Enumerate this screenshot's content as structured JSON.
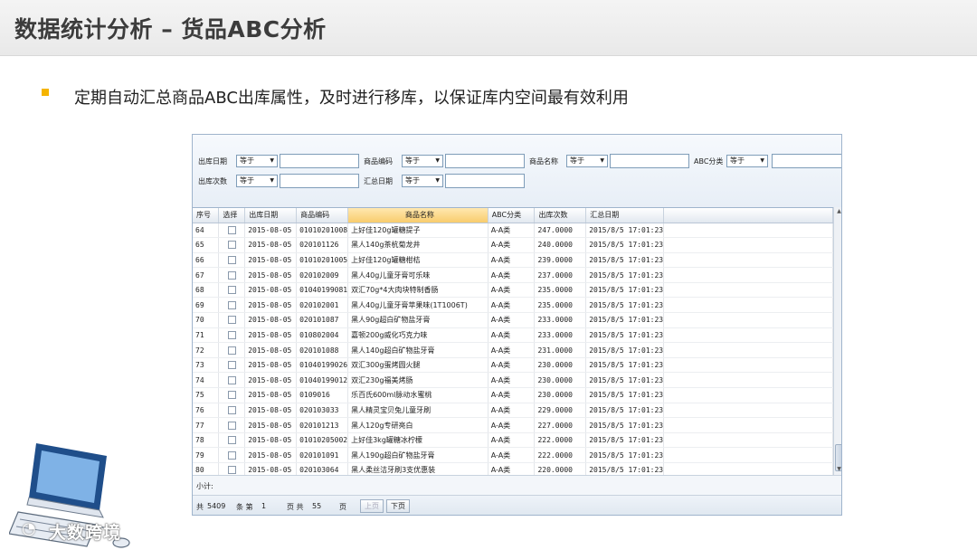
{
  "slide": {
    "title": "数据统计分析 – 货品ABC分析",
    "bullet": "定期自动汇总商品ABC出库属性，及时进行移库，以保证库内空间最有效利用",
    "watermark": "大数跨境",
    "accent_color": "#f5b400"
  },
  "filters": {
    "row1": [
      {
        "label": "出库日期",
        "op": "等于"
      },
      {
        "label": "商品编码",
        "op": "等于"
      },
      {
        "label": "商品名称",
        "op": "等于"
      },
      {
        "label": "ABC分类",
        "op": "等于"
      }
    ],
    "row2": [
      {
        "label": "出库次数",
        "op": "等于"
      },
      {
        "label": "汇总日期",
        "op": "等于"
      }
    ]
  },
  "table": {
    "columns": [
      "序号",
      "选择",
      "出库日期",
      "商品编码",
      "商品名称",
      "ABC分类",
      "出库次数",
      "汇总日期"
    ],
    "rows": [
      [
        "64",
        "",
        "2015-08-05",
        "01010201008",
        "上好佳120g罐糖提子",
        "A-A类",
        "247.0000",
        "2015/8/5 17:01:23"
      ],
      [
        "65",
        "",
        "2015-08-05",
        "020101126",
        "黑人140g茶杭菊龙井",
        "A-A类",
        "240.0000",
        "2015/8/5 17:01:23"
      ],
      [
        "66",
        "",
        "2015-08-05",
        "01010201005",
        "上好佳120g罐糖柑桔",
        "A-A类",
        "239.0000",
        "2015/8/5 17:01:23"
      ],
      [
        "67",
        "",
        "2015-08-05",
        "020102009",
        "黑人40g儿童牙膏可乐味",
        "A-A类",
        "237.0000",
        "2015/8/5 17:01:23"
      ],
      [
        "68",
        "",
        "2015-08-05",
        "01040199081",
        "双汇70g*4大肉块特制香肠",
        "A-A类",
        "235.0000",
        "2015/8/5 17:01:23"
      ],
      [
        "69",
        "",
        "2015-08-05",
        "020102001",
        "黑人40g儿童牙膏苹果味(1T1006T)",
        "A-A类",
        "235.0000",
        "2015/8/5 17:01:23"
      ],
      [
        "70",
        "",
        "2015-08-05",
        "020101087",
        "黑人90g超白矿物盐牙膏",
        "A-A类",
        "233.0000",
        "2015/8/5 17:01:23"
      ],
      [
        "71",
        "",
        "2015-08-05",
        "010802004",
        "嘉顿200g威化巧克力味",
        "A-A类",
        "233.0000",
        "2015/8/5 17:01:23"
      ],
      [
        "72",
        "",
        "2015-08-05",
        "020101088",
        "黑人140g超白矿物盐牙膏",
        "A-A类",
        "231.0000",
        "2015/8/5 17:01:23"
      ],
      [
        "73",
        "",
        "2015-08-05",
        "01040199026",
        "双汇300g蛋烤圆火腿",
        "A-A类",
        "230.0000",
        "2015/8/5 17:01:23"
      ],
      [
        "74",
        "",
        "2015-08-05",
        "01040199012",
        "双汇230g福美烤肠",
        "A-A类",
        "230.0000",
        "2015/8/5 17:01:23"
      ],
      [
        "75",
        "",
        "2015-08-05",
        "0109016",
        "乐百氏600ml脉动水蜜桃",
        "A-A类",
        "230.0000",
        "2015/8/5 17:01:23"
      ],
      [
        "76",
        "",
        "2015-08-05",
        "020103033",
        "黑人精灵宝贝兔儿童牙刷",
        "A-A类",
        "229.0000",
        "2015/8/5 17:01:23"
      ],
      [
        "77",
        "",
        "2015-08-05",
        "020101213",
        "黑人120g专研亮白",
        "A-A类",
        "227.0000",
        "2015/8/5 17:01:23"
      ],
      [
        "78",
        "",
        "2015-08-05",
        "01010205002",
        "上好佳3kg罐糖冰柠檬",
        "A-A类",
        "222.0000",
        "2015/8/5 17:01:23"
      ],
      [
        "79",
        "",
        "2015-08-05",
        "020101091",
        "黑人190g超白矿物盐牙膏",
        "A-A类",
        "222.0000",
        "2015/8/5 17:01:23"
      ],
      [
        "80",
        "",
        "2015-08-05",
        "020103064",
        "黑人柔丝洁牙刷3支优惠装",
        "A-A类",
        "220.0000",
        "2015/8/5 17:01:23"
      ]
    ]
  },
  "summary": {
    "label": "小计:"
  },
  "pager": {
    "total_prefix": "共",
    "total": "5409",
    "rows_unit": "条 第",
    "page": "1",
    "pages_prefix": "页 共",
    "pages": "55",
    "pages_unit": "页",
    "prev_label": "上页",
    "next_label": "下页"
  }
}
